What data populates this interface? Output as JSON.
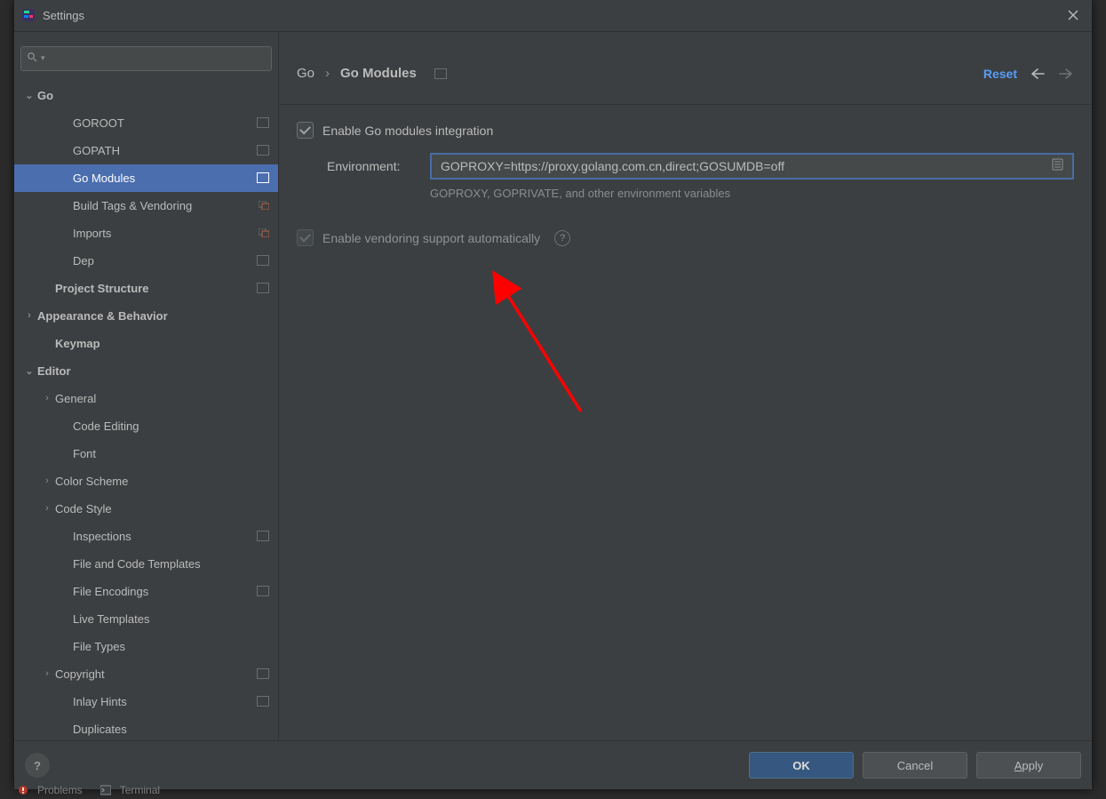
{
  "window": {
    "title": "Settings"
  },
  "search": {
    "placeholder": "",
    "value": ""
  },
  "sidebar": [
    {
      "label": "Go",
      "indent": 0,
      "arrow": "down",
      "bold": true,
      "proj": false
    },
    {
      "label": "GOROOT",
      "indent": 2,
      "arrow": "",
      "bold": false,
      "proj": true
    },
    {
      "label": "GOPATH",
      "indent": 2,
      "arrow": "",
      "bold": false,
      "proj": true
    },
    {
      "label": "Go Modules",
      "indent": 2,
      "arrow": "",
      "bold": false,
      "proj": true,
      "selected": true
    },
    {
      "label": "Build Tags & Vendoring",
      "indent": 2,
      "arrow": "",
      "bold": false,
      "proj": true,
      "projStyle": "expand"
    },
    {
      "label": "Imports",
      "indent": 2,
      "arrow": "",
      "bold": false,
      "proj": true,
      "projStyle": "expand"
    },
    {
      "label": "Dep",
      "indent": 2,
      "arrow": "",
      "bold": false,
      "proj": true
    },
    {
      "label": "Project Structure",
      "indent": 1,
      "arrow": "",
      "bold": true,
      "proj": true
    },
    {
      "label": "Appearance & Behavior",
      "indent": 0,
      "arrow": "right",
      "bold": true
    },
    {
      "label": "Keymap",
      "indent": 1,
      "arrow": "",
      "bold": true
    },
    {
      "label": "Editor",
      "indent": 0,
      "arrow": "down",
      "bold": true
    },
    {
      "label": "General",
      "indent": 1,
      "arrow": "right",
      "bold": false
    },
    {
      "label": "Code Editing",
      "indent": 2,
      "arrow": "",
      "bold": false
    },
    {
      "label": "Font",
      "indent": 2,
      "arrow": "",
      "bold": false
    },
    {
      "label": "Color Scheme",
      "indent": 1,
      "arrow": "right",
      "bold": false
    },
    {
      "label": "Code Style",
      "indent": 1,
      "arrow": "right",
      "bold": false
    },
    {
      "label": "Inspections",
      "indent": 2,
      "arrow": "",
      "bold": false,
      "proj": true
    },
    {
      "label": "File and Code Templates",
      "indent": 2,
      "arrow": "",
      "bold": false
    },
    {
      "label": "File Encodings",
      "indent": 2,
      "arrow": "",
      "bold": false,
      "proj": true
    },
    {
      "label": "Live Templates",
      "indent": 2,
      "arrow": "",
      "bold": false
    },
    {
      "label": "File Types",
      "indent": 2,
      "arrow": "",
      "bold": false
    },
    {
      "label": "Copyright",
      "indent": 1,
      "arrow": "right",
      "bold": false,
      "proj": true
    },
    {
      "label": "Inlay Hints",
      "indent": 2,
      "arrow": "",
      "bold": false,
      "proj": true
    },
    {
      "label": "Duplicates",
      "indent": 2,
      "arrow": "",
      "bold": false
    }
  ],
  "breadcrumb": {
    "root": "Go",
    "leaf": "Go Modules"
  },
  "headerActions": {
    "reset": "Reset"
  },
  "form": {
    "enableModulesLabel": "Enable Go modules integration",
    "enableModulesChecked": true,
    "envLabel": "Environment:",
    "envValue": "GOPROXY=https://proxy.golang.com.cn,direct;GOSUMDB=off",
    "envHint": "GOPROXY, GOPRIVATE, and other environment variables",
    "enableVendoringLabel": "Enable vendoring support automatically",
    "enableVendoringChecked": true
  },
  "footer": {
    "ok": "OK",
    "cancel": "Cancel",
    "apply": "Apply"
  },
  "ideBottom": {
    "problems": "Problems",
    "terminal": "Terminal"
  }
}
